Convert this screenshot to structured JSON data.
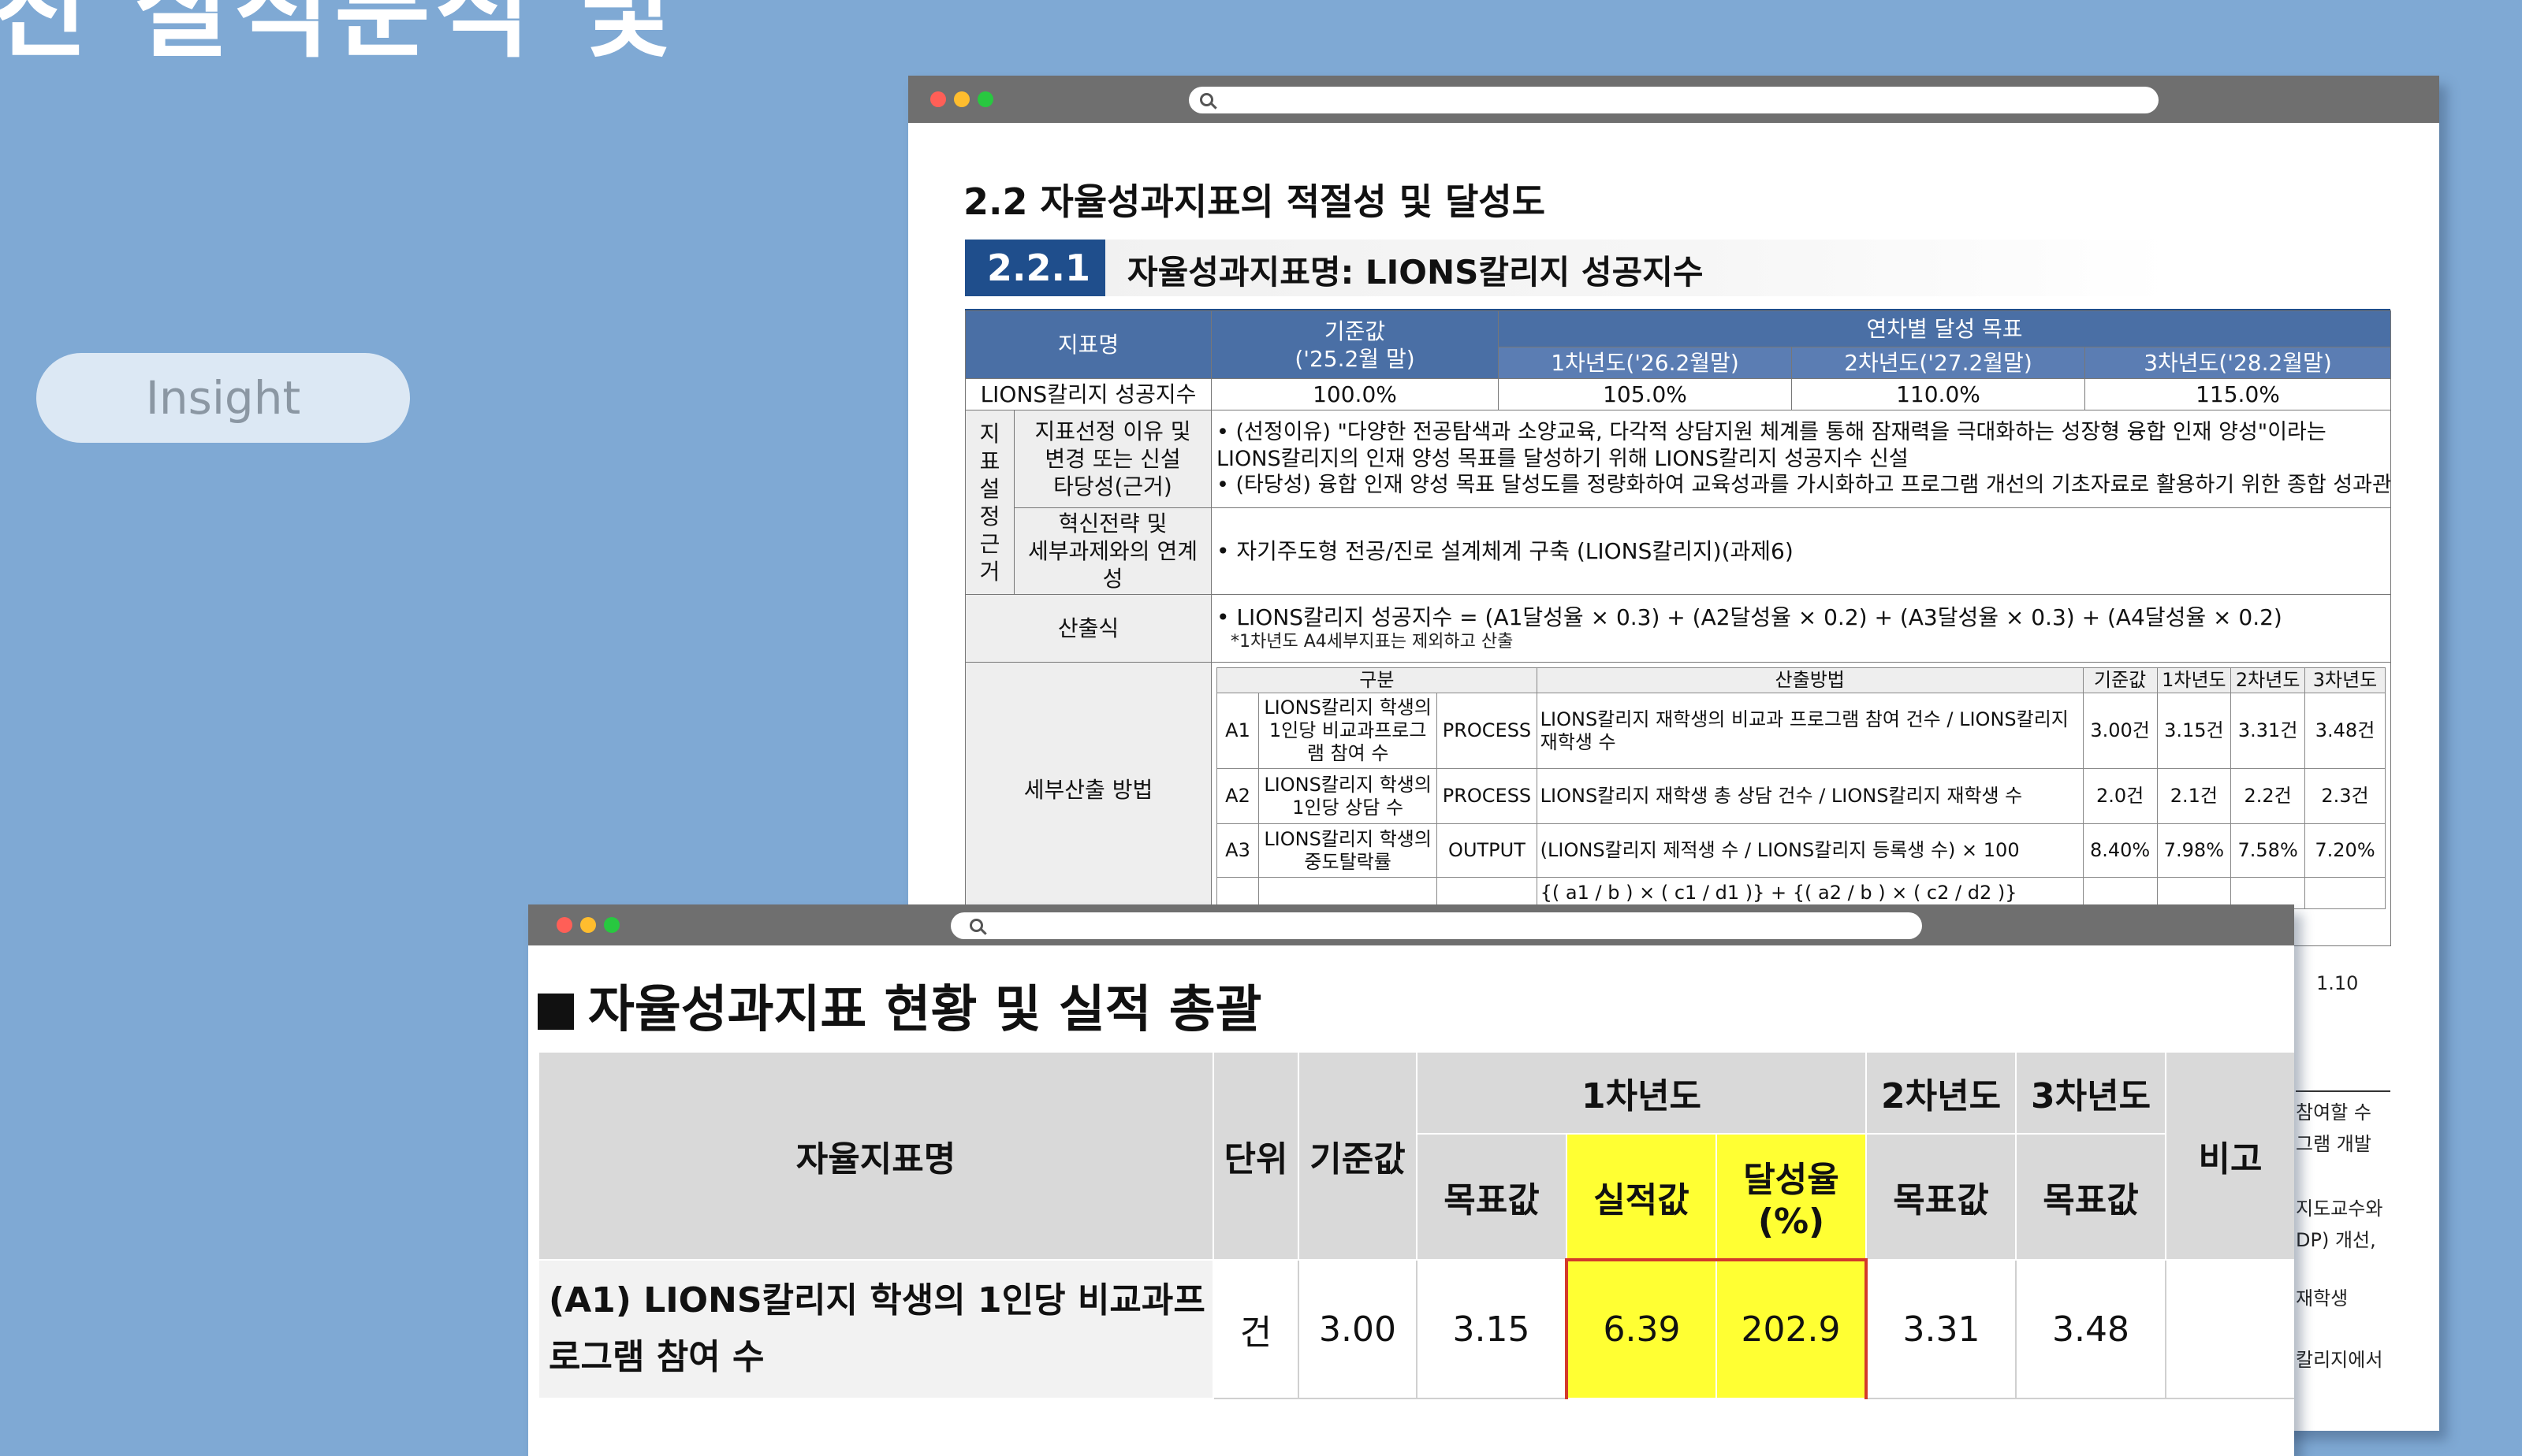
{
  "slide": {
    "heading_fragment": "진 실적분석 및",
    "insight_label": "Insight"
  },
  "back_doc": {
    "section_heading": "2.2 자율성과지표의 적절성 및 달성도",
    "sub_number": "2.2.1",
    "sub_title": "자율성과지표명: LIONS칼리지 성공지수",
    "table": {
      "h_indicator": "지표명",
      "h_base": "기준값\n('25.2월 말)",
      "h_targets": "연차별 달성 목표",
      "h_y1": "1차년도('26.2월말)",
      "h_y2": "2차년도('27.2월말)",
      "h_y3": "3차년도('28.2월말)",
      "indicator_name": "LIONS칼리지 성공지수",
      "base_value": "100.0%",
      "y1_value": "105.0%",
      "y2_value": "110.0%",
      "y3_value": "115.0%",
      "basis_group": "지표\n설정\n근거",
      "reason_label": "지표선정 이유 및\n변경 또는 신설\n타당성(근거)",
      "reason_text_1": "• (선정이유) \"다양한 전공탐색과 소양교육, 다각적 상담지원 체계를 통해 잠재력을 극대화하는 성장형 융합 인재 양성\"이라는 LIONS칼리지의 인재 양성 목표를 달성하기 위해 LIONS칼리지 성공지수 신설",
      "reason_text_2": "• (타당성) 융합 인재 양성 목표 달성도를 정량화하여 교육성과를 가시화하고 프로그램 개선의 기초자료로 활용하기 위한 종합 성과관리 지표",
      "link_label": "혁신전략 및\n세부과제와의 연계성",
      "link_text": "• 자기주도형 전공/진로 설계체계 구축 (LIONS칼리지)(과제6)",
      "formula_label": "산출식",
      "formula_text": "• LIONS칼리지 성공지수 = (A1달성율 × 0.3) + (A2달성율 × 0.2) + (A3달성율 × 0.3) + (A4달성율 × 0.2)",
      "formula_note": "*1차년도 A4세부지표는 제외하고 산출",
      "detail_label": "세부산출 방법",
      "inner_headers": [
        "구분",
        "산출방법",
        "기준값",
        "1차년도",
        "2차년도",
        "3차년도"
      ],
      "inner_rows": [
        {
          "code": "A1",
          "name": "LIONS칼리지 학생의 1인당 비교과프로그램 참여 수",
          "type": "PROCESS",
          "method": "LIONS칼리지 재학생의 비교과 프로그램 참여 건수 / LIONS칼리지 재학생 수",
          "base": "3.00건",
          "y1": "3.15건",
          "y2": "3.31건",
          "y3": "3.48건"
        },
        {
          "code": "A2",
          "name": "LIONS칼리지 학생의 1인당 상담 수",
          "type": "PROCESS",
          "method": "LIONS칼리지 재학생 총 상담 건수 / LIONS칼리지 재학생 수",
          "base": "2.0건",
          "y1": "2.1건",
          "y2": "2.2건",
          "y3": "2.3건"
        },
        {
          "code": "A3",
          "name": "LIONS칼리지 학생의 중도탈락률",
          "type": "OUTPUT",
          "method": "(LIONS칼리지 제적생 수 / LIONS칼리지 등록생 수) × 100",
          "base": "8.40%",
          "y1": "7.98%",
          "y2": "7.58%",
          "y3": "7.20%"
        },
        {
          "code": "",
          "name": "",
          "type": "",
          "method": "{( a1 / b ) × ( c1 / d1 )} + {( a2 / b ) × ( c2 / d2 )}",
          "base": "",
          "y1": "",
          "y2": "",
          "y3": ""
        }
      ]
    },
    "side_fragments": [
      "1.10",
      "참여할 수",
      "그램 개발",
      "지도교수와",
      "DP) 개선,",
      "재학생",
      "칼리지에서"
    ]
  },
  "front_doc": {
    "title": "자율성과지표 현황 및 실적 총괄",
    "headers": {
      "name": "자율지표명",
      "unit": "단위",
      "base": "기준값",
      "y1": "1차년도",
      "y2": "2차년도",
      "y3": "3차년도",
      "note": "비고",
      "target": "목표값",
      "actual": "실적값",
      "rate": "달성율(%)",
      "y2_target": "목표값",
      "y3_target": "목표값"
    },
    "rows": [
      {
        "name": "(A1) LIONS칼리지 학생의 1인당 비교과프로그램 참여 수",
        "unit": "건",
        "base": "3.00",
        "y1_target": "3.15",
        "y1_actual": "6.39",
        "y1_rate": "202.9",
        "y2_target": "3.31",
        "y3_target": "3.48",
        "note": ""
      }
    ]
  },
  "colors": {
    "background": "#7fa9d4",
    "doc_header_blue": "#4a6fa5",
    "highlight_yellow": "#ffff33",
    "highlight_border": "#d33a2a"
  }
}
